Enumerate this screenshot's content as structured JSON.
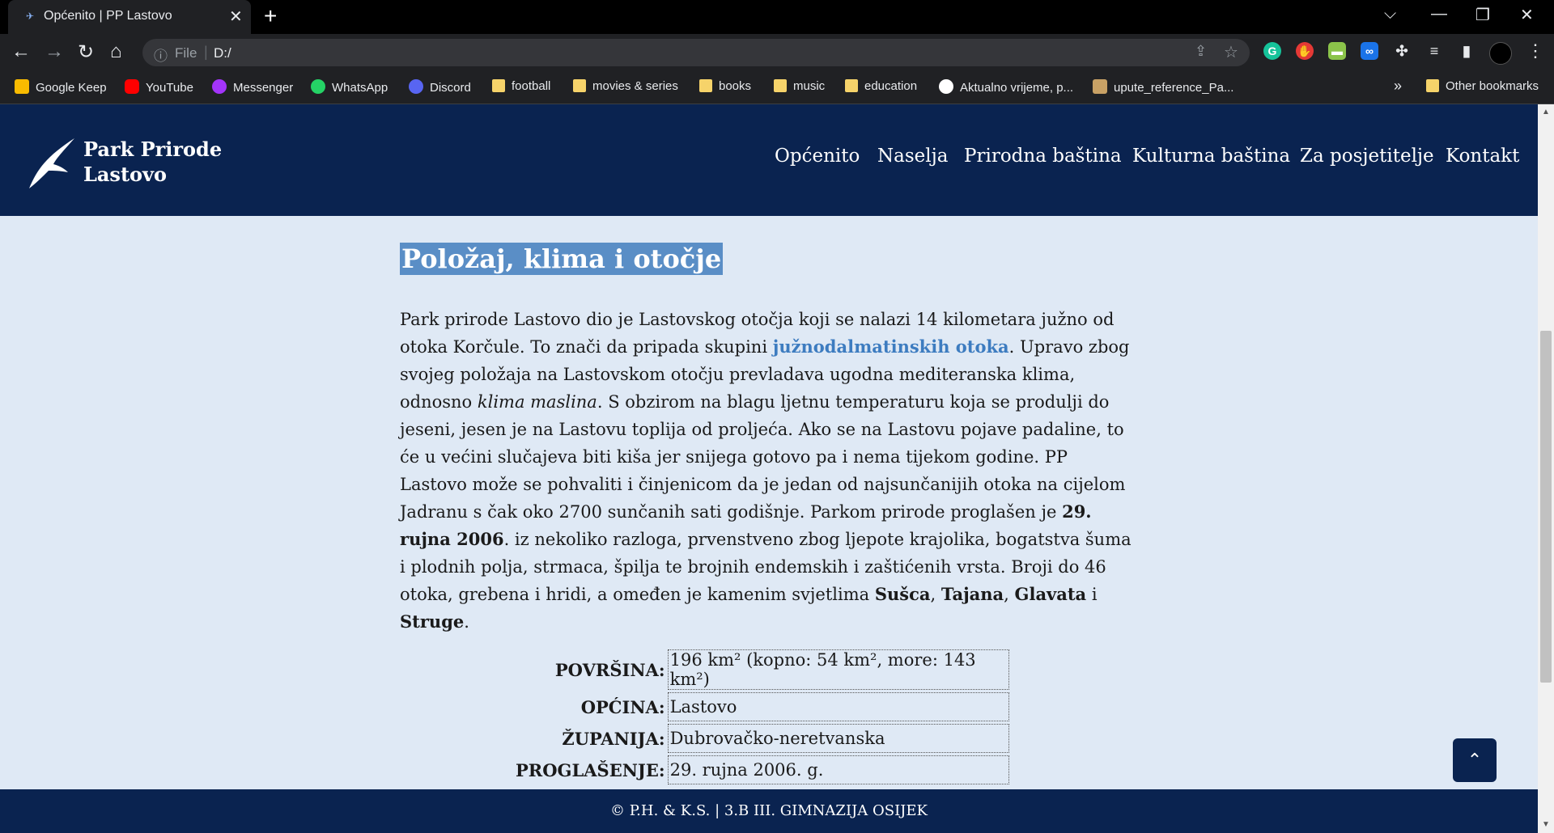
{
  "browser": {
    "tab_title": "Općenito | PP Lastovo",
    "omnibox_scheme": "File",
    "omnibox_url": "D:/",
    "bookmarks": [
      {
        "label": "Google Keep",
        "icon": "google-keep-icon",
        "color": "#f9bb00"
      },
      {
        "label": "YouTube",
        "icon": "youtube-icon",
        "color": "#ff0000"
      },
      {
        "label": "Messenger",
        "icon": "messenger-icon",
        "color": "#a334fa"
      },
      {
        "label": "WhatsApp",
        "icon": "whatsapp-icon",
        "color": "#25d366"
      },
      {
        "label": "Discord",
        "icon": "discord-icon",
        "color": "#5865f2"
      },
      {
        "label": "football",
        "icon": "folder-icon",
        "color": "#f6d36a"
      },
      {
        "label": "movies & series",
        "icon": "folder-icon",
        "color": "#f6d36a"
      },
      {
        "label": "books",
        "icon": "folder-icon",
        "color": "#f6d36a"
      },
      {
        "label": "music",
        "icon": "folder-icon",
        "color": "#f6d36a"
      },
      {
        "label": "education",
        "icon": "folder-icon",
        "color": "#f6d36a"
      },
      {
        "label": "Aktualno vrijeme, p...",
        "icon": "globe-icon",
        "color": "#ffffff"
      },
      {
        "label": "upute_reference_Pa...",
        "icon": "document-icon",
        "color": "#c8a165"
      }
    ],
    "other_bookmarks": "Other bookmarks",
    "more_glyph": "»"
  },
  "site": {
    "logo_line1": "Park Prirode",
    "logo_line2": "Lastovo",
    "nav": [
      "Općenito",
      "Naselja",
      "Prirodna baština",
      "Kulturna baština",
      "Za posjetitelje",
      "Kontakt"
    ],
    "heading": "Položaj, klima i otočje",
    "para": {
      "t1": "Park prirode Lastovo dio je Lastovskog otočja koji se nalazi 14 kilometara južno od otoka Korčule. To znači da pripada skupini ",
      "link": "južnodalmatinskih otoka",
      "t2": ". Upravo zbog svojeg položaja na Lastovskom otočju prevladava ugodna mediteranska klima, odnosno ",
      "italic": "klima maslina",
      "t3": ". S obzirom na blagu ljetnu temperaturu koja se produlji do jeseni, jesen je na Lastovu toplija od proljeća. Ako se na Lastovu pojave padaline, to će u većini slučajeva biti kiša jer snijega gotovo pa i nema tijekom godine. PP Lastovo može se pohvaliti i činjenicom da je jedan od najsunčanijih otoka na cijelom Jadranu s čak oko 2700 sunčanih sati godišnje. Parkom prirode proglašen je ",
      "bold_date": "29. rujna 2006",
      "t4": ". iz nekoliko razloga, prvenstveno zbog ljepote krajolika, bogatstva šuma i plodnih polja, strmaca, špilja te brojnih endemskih i zaštićenih vrsta. Broji do 46 otoka, grebena i hridi, a omeđen je kamenim svjetlima ",
      "b1": "Sušca",
      "c1": ", ",
      "b2": "Tajana",
      "c2": ", ",
      "b3": "Glavata",
      "c3": " i ",
      "b4": "Struge",
      "t5": "."
    },
    "info_rows": [
      {
        "label": "POVRŠINA:",
        "value": "196 km² (kopno: 54 km², more: 143 km²)"
      },
      {
        "label": "OPĆINA:",
        "value": "Lastovo"
      },
      {
        "label": "ŽUPANIJA:",
        "value": "Dubrovačko-neretvanska"
      },
      {
        "label": "PROGLAŠENJE:",
        "value": "29. rujna 2006. g."
      }
    ],
    "footer": "© P.H. & K.S. | 3.B III. GIMNAZIJA OSIJEK",
    "to_top_glyph": "⌃"
  },
  "colors": {
    "header_bg": "#0a2350",
    "page_bg": "#dfe9f5",
    "heading_highlight": "#5a8ec6",
    "link": "#3d7cc0"
  }
}
